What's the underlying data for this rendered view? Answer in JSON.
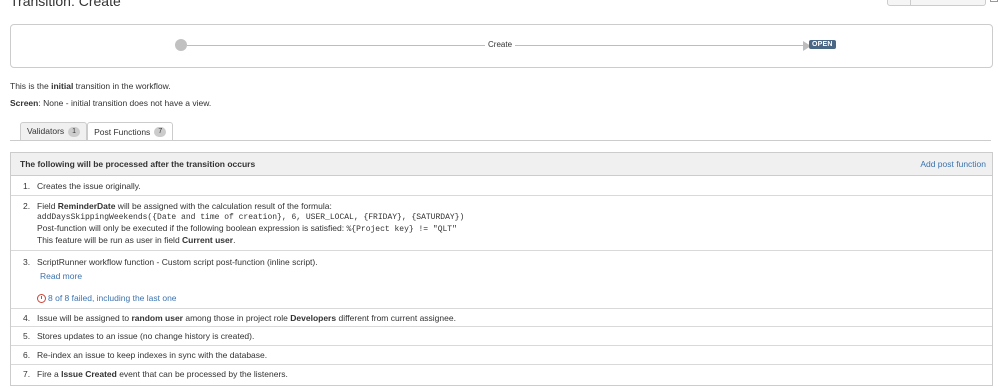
{
  "page": {
    "title": "Transition: Create"
  },
  "diagram": {
    "transition_label": "Create",
    "target_status": "OPEN",
    "status_color": "#4a6785"
  },
  "info": {
    "line1_prefix": "This is the ",
    "line1_bold": "initial",
    "line1_suffix": " transition in the workflow.",
    "screen_label": "Screen",
    "screen_value": ": None - initial transition does not have a view."
  },
  "tabs": [
    {
      "label": "Validators",
      "count": "1"
    },
    {
      "label": "Post Functions",
      "count": "7"
    }
  ],
  "post_functions": {
    "header": "The following will be processed after the transition occurs",
    "add_link": "Add post function",
    "items": [
      {
        "num": "1.",
        "text": "Creates the issue originally."
      },
      {
        "num": "2.",
        "l1a": "Field ",
        "l1b": "ReminderDate",
        "l1c": " will be assigned with the calculation result of the formula:",
        "l2": "addDaysSkippingWeekends({Date and time of creation}, 6, USER_LOCAL, {FRIDAY}, {SATURDAY})",
        "l3a": "Post-function will only be executed if the following boolean expression is satisfied: ",
        "l3b": "%{Project key} != \"QLT\"",
        "l4a": "This feature will be run as user in field ",
        "l4b": "Current user",
        "l4c": "."
      },
      {
        "num": "3.",
        "text": "ScriptRunner workflow function - Custom script post-function (inline script).",
        "read_more": "Read more",
        "failed": "8 of 8 failed, including the last one"
      },
      {
        "num": "4.",
        "a": "Issue will be assigned to ",
        "b": "random user",
        "c": " among those in project role ",
        "d": "Developers",
        "e": " different from current assignee."
      },
      {
        "num": "5.",
        "text": "Stores updates to an issue (no change history is created)."
      },
      {
        "num": "6.",
        "text": "Re-index an issue to keep indexes in sync with the database."
      },
      {
        "num": "7.",
        "a": "Fire a ",
        "b": "Issue Created",
        "c": " event that can be processed by the listeners."
      }
    ]
  },
  "colors": {
    "link": "#3b73af",
    "error": "#d04437",
    "border": "#cccccc"
  }
}
